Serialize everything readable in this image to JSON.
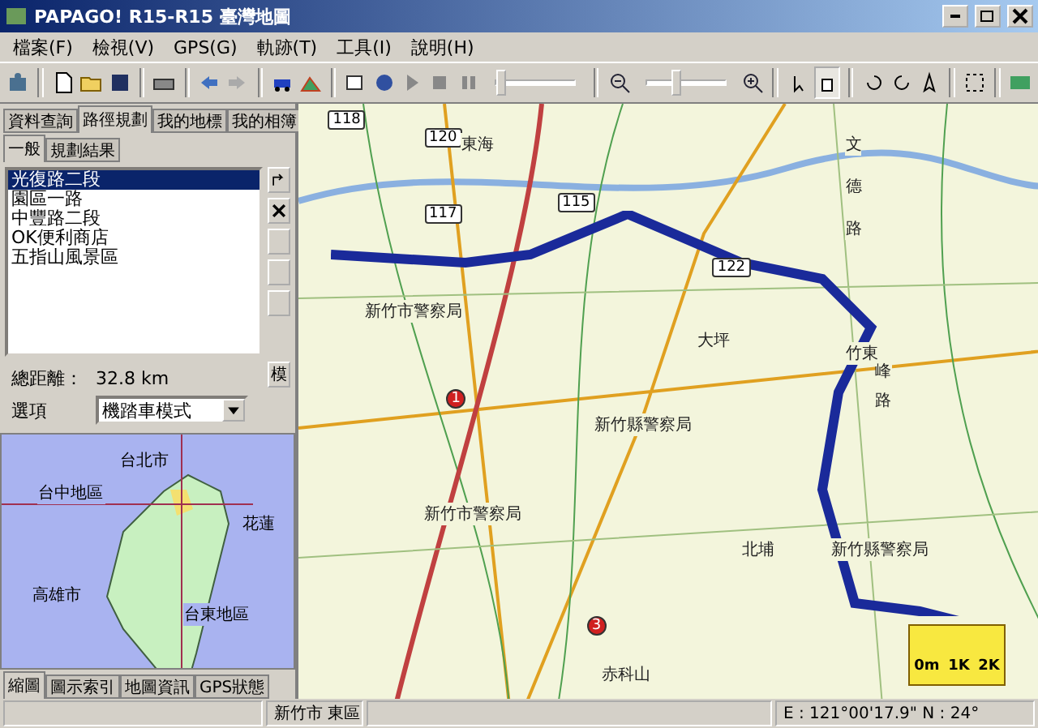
{
  "window": {
    "title": "PAPAGO! R15-R15 臺灣地圖"
  },
  "menu": [
    "檔案(F)",
    "檢視(V)",
    "GPS(G)",
    "軌跡(T)",
    "工具(I)",
    "說明(H)"
  ],
  "toolbar": {
    "playback_slider": {
      "level": 0.02
    },
    "zoom_slider": {
      "level": 0.33
    }
  },
  "left_panel": {
    "tabs": [
      {
        "label": "資料查詢",
        "selected": false
      },
      {
        "label": "路徑規劃",
        "selected": true
      },
      {
        "label": "我的地標",
        "selected": false
      },
      {
        "label": "我的相簿",
        "selected": false
      }
    ],
    "subtabs": [
      {
        "label": "一般",
        "selected": true
      },
      {
        "label": "規劃結果",
        "selected": false
      }
    ],
    "route_points": [
      {
        "label": "光復路二段",
        "selected": true
      },
      {
        "label": "園區一路",
        "selected": false
      },
      {
        "label": "中豐路二段",
        "selected": false
      },
      {
        "label": "OK便利商店",
        "selected": false
      },
      {
        "label": "五指山風景區",
        "selected": false
      }
    ],
    "side_button_label": "模",
    "total_distance": {
      "label": "總距離：",
      "value": "32.8 km"
    },
    "option": {
      "label": "選項",
      "value": "機踏車模式"
    },
    "overview_labels": [
      "台北市",
      "台中地區",
      "花蓮",
      "高雄市",
      "台東地區"
    ],
    "bottom_tabs": [
      {
        "label": "縮圖",
        "selected": true
      },
      {
        "label": "圖示索引",
        "selected": false
      },
      {
        "label": "地圖資訊",
        "selected": false
      },
      {
        "label": "GPS狀態",
        "selected": false
      }
    ]
  },
  "map": {
    "shields": [
      "118",
      "120",
      "117",
      "115",
      "122",
      "1",
      "3"
    ],
    "labels": [
      "東海",
      "文",
      "德",
      "路",
      "新竹市警察局",
      "新竹縣警察局",
      "新竹縣警察局",
      "赤科山",
      "大坪",
      "竹東",
      "峰",
      "路",
      "新竹市警察局",
      "北埔"
    ],
    "scale": [
      "0m",
      "1K",
      "2K"
    ]
  },
  "status_bar": [
    "新竹市 東區",
    "E : 121°00'17.9\"  N : 24°"
  ]
}
